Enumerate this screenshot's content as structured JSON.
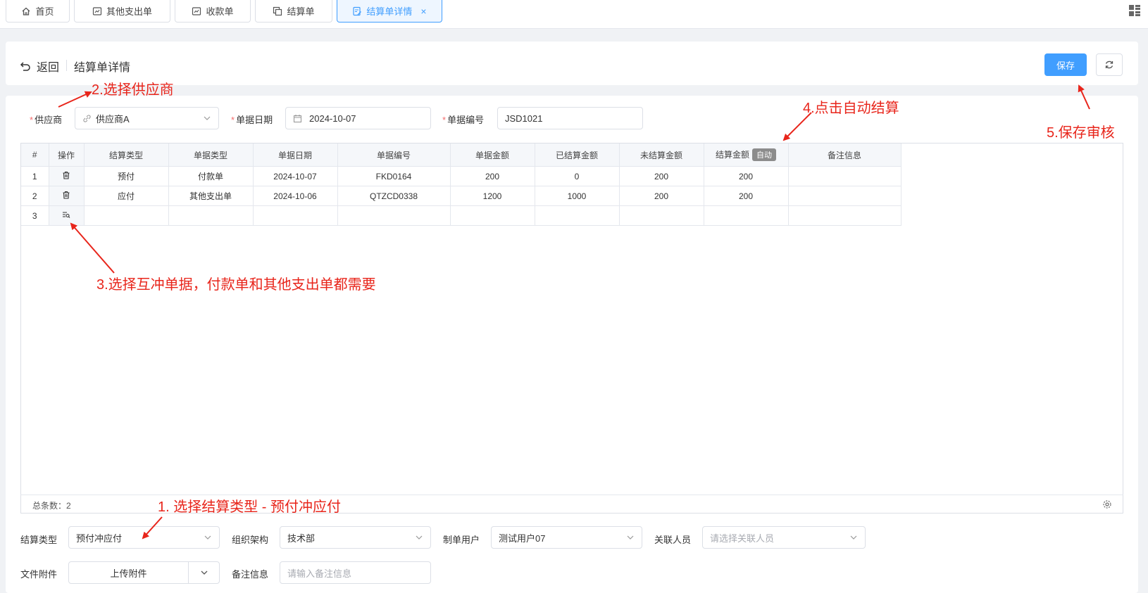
{
  "tabs": [
    {
      "label": "首页",
      "icon": "home-icon"
    },
    {
      "label": "其他支出单",
      "icon": "document-icon"
    },
    {
      "label": "收款单",
      "icon": "document-icon"
    },
    {
      "label": "结算单",
      "icon": "copy-icon"
    },
    {
      "label": "结算单详情",
      "icon": "edit-document-icon",
      "active": true,
      "close": "×"
    }
  ],
  "header": {
    "back_label": "返回",
    "title": "结算单详情",
    "save_label": "保存"
  },
  "form_top": {
    "supplier_label": "供应商",
    "supplier_value": "供应商A",
    "date_label": "单据日期",
    "date_value": "2024-10-07",
    "number_label": "单据编号",
    "number_value": "JSD1021"
  },
  "table": {
    "columns": [
      "#",
      "操作",
      "结算类型",
      "单据类型",
      "单据日期",
      "单据编号",
      "单据金额",
      "已结算金额",
      "未结算金额",
      "结算金额",
      "备注信息"
    ],
    "auto_badge": "自动",
    "rows": [
      [
        "1",
        "",
        "预付",
        "付款单",
        "2024-10-07",
        "FKD0164",
        "200",
        "0",
        "200",
        "200",
        ""
      ],
      [
        "2",
        "",
        "应付",
        "其他支出单",
        "2024-10-06",
        "QTZCD0338",
        "1200",
        "1000",
        "200",
        "200",
        ""
      ],
      [
        "3",
        "",
        "",
        "",
        "",
        "",
        "",
        "",
        "",
        "",
        ""
      ]
    ],
    "total_label": "总条数：2"
  },
  "form_bottom": {
    "settle_type_label": "结算类型",
    "settle_type_value": "预付冲应付",
    "org_label": "组织架构",
    "org_value": "技术部",
    "user_label": "制单用户",
    "user_value": "测试用户07",
    "related_label": "关联人员",
    "related_placeholder": "请选择关联人员",
    "attach_label": "文件附件",
    "attach_button": "上传附件",
    "remark_label": "备注信息",
    "remark_placeholder": "请输入备注信息"
  },
  "annotations": {
    "a1": "1. 选择结算类型 - 预付冲应付",
    "a2": "2.选择供应商",
    "a3": "3.选择互冲单据，付款单和其他支出单都需要",
    "a4": "4.点击自动结算",
    "a5": "5.保存审核"
  },
  "colors": {
    "primary": "#409eff",
    "annotation": "#e8251b",
    "required": "#f56c6c"
  }
}
